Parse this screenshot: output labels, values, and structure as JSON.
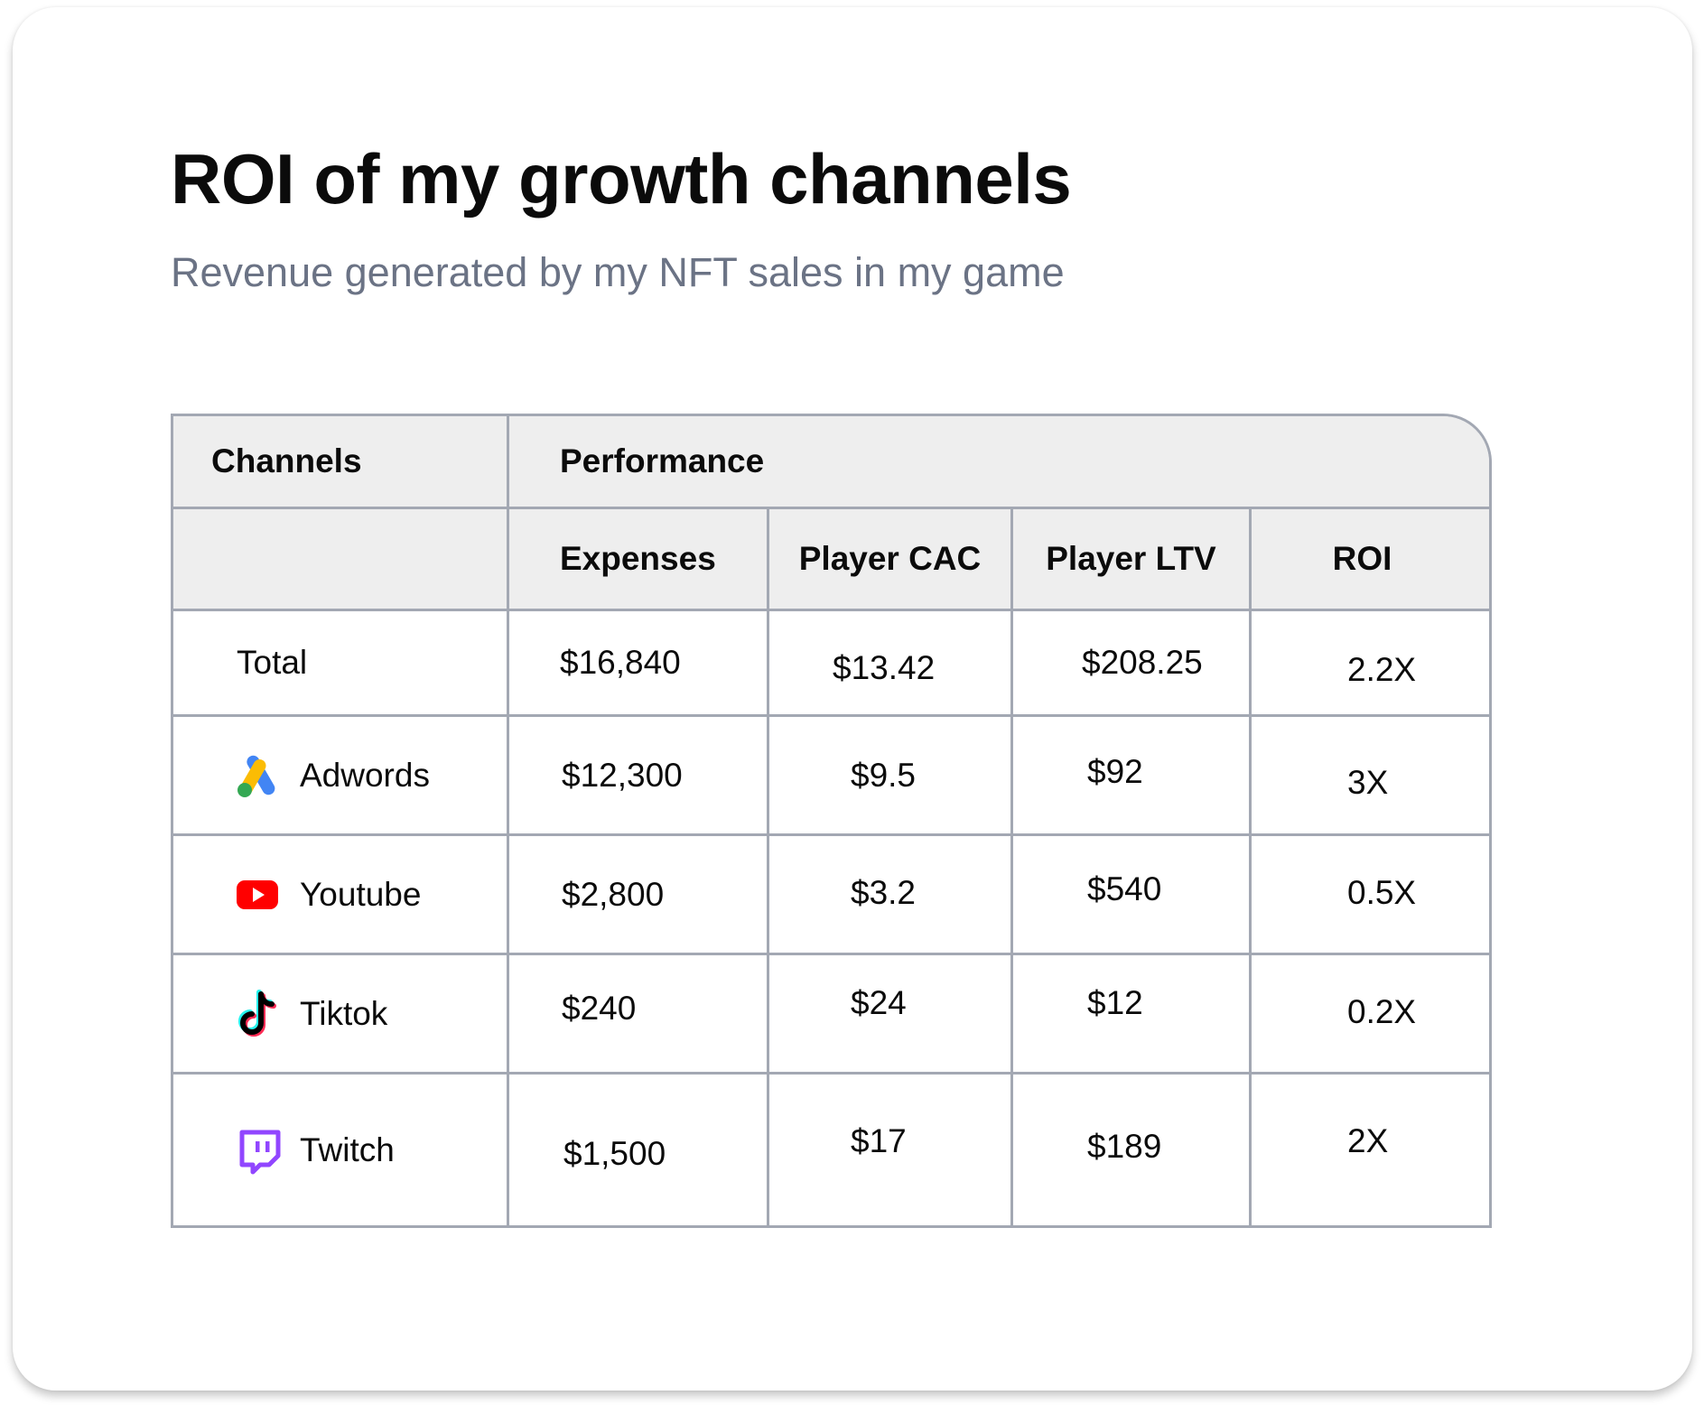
{
  "card": {
    "title": "ROI of my growth channels",
    "subtitle": "Revenue generated by my NFT sales in my game"
  },
  "table": {
    "group_headers": {
      "channels": "Channels",
      "performance": "Performance"
    },
    "columns": [
      "Expenses",
      "Player CAC",
      "Player LTV",
      "ROI"
    ],
    "rows": [
      {
        "channel": "Total",
        "icon": "",
        "expenses": "$16,840",
        "cac": "$13.42",
        "ltv": "$208.25",
        "roi": "2.2X"
      },
      {
        "channel": "Adwords",
        "icon": "google-ads-icon",
        "expenses": "$12,300",
        "cac": "$9.5",
        "ltv": "$92",
        "roi": "3X"
      },
      {
        "channel": "Youtube",
        "icon": "youtube-icon",
        "expenses": "$2,800",
        "cac": "$3.2",
        "ltv": "$540",
        "roi": "0.5X"
      },
      {
        "channel": "Tiktok",
        "icon": "tiktok-icon",
        "expenses": "$240",
        "cac": "$24",
        "ltv": "$12",
        "roi": "0.2X"
      },
      {
        "channel": "Twitch",
        "icon": "twitch-icon",
        "expenses": "$1,500",
        "cac": "$17",
        "ltv": "$189",
        "roi": "2X"
      }
    ]
  },
  "colors": {
    "title": "#0b0b0b",
    "subtitle": "#6b7385",
    "header_bg": "#eeeeee",
    "border": "#a3a8b3",
    "youtube_red": "#ff0000",
    "twitch_purple": "#9146ff",
    "google_blue": "#4285f4",
    "google_yellow": "#fbbc04",
    "google_green": "#34a853"
  }
}
